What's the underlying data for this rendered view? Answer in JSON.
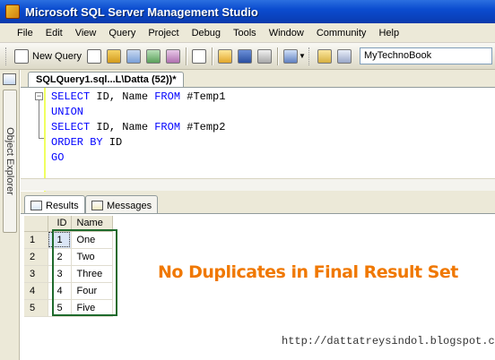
{
  "window": {
    "title": "Microsoft SQL Server Management Studio"
  },
  "menu": [
    "File",
    "Edit",
    "View",
    "Query",
    "Project",
    "Debug",
    "Tools",
    "Window",
    "Community",
    "Help"
  ],
  "toolbar": {
    "new_query_label": "New Query",
    "database": "MyTechnoBook",
    "icons": [
      "new-query-icon",
      "new-file-icon",
      "database-query-icon",
      "mdx-query-icon",
      "dmx-query-icon",
      "xmla-query-icon",
      "copy-icon",
      "open-file-icon",
      "save-icon",
      "print-icon",
      "activity-monitor-icon",
      "query-options-icon",
      "template-icon"
    ]
  },
  "side_panel": {
    "label": "Object Explorer"
  },
  "document_tab": {
    "label": "SQLQuery1.sql...L\\Datta (52))*"
  },
  "editor": {
    "lines": [
      [
        {
          "t": "SELECT",
          "kw": true
        },
        {
          "t": " ID, Name ",
          "kw": false
        },
        {
          "t": "FROM",
          "kw": true
        },
        {
          "t": " #Temp1",
          "kw": false
        }
      ],
      [
        {
          "t": "UNION",
          "kw": true
        }
      ],
      [
        {
          "t": "SELECT",
          "kw": true
        },
        {
          "t": " ID, Name ",
          "kw": false
        },
        {
          "t": "FROM",
          "kw": true
        },
        {
          "t": " #Temp2",
          "kw": false
        }
      ],
      [
        {
          "t": "ORDER BY",
          "kw": true
        },
        {
          "t": " ID",
          "kw": false
        }
      ],
      [
        {
          "t": "GO",
          "kw": true
        }
      ]
    ]
  },
  "results_tabs": {
    "results": "Results",
    "messages": "Messages"
  },
  "grid": {
    "headers": [
      "ID",
      "Name"
    ],
    "rows": [
      {
        "num": "1",
        "id": "1",
        "name": "One"
      },
      {
        "num": "2",
        "id": "2",
        "name": "Two"
      },
      {
        "num": "3",
        "id": "3",
        "name": "Three"
      },
      {
        "num": "4",
        "id": "4",
        "name": "Four"
      },
      {
        "num": "5",
        "id": "5",
        "name": "Five"
      }
    ]
  },
  "annotation": "No Duplicates in Final Result Set",
  "watermark": "http://dattatreysindol.blogspot.com",
  "colors": {
    "keyword": "#0000ff",
    "annotation": "#f07800",
    "highlight_box": "#1e6a2c",
    "titlebar": "#0b4ccf"
  }
}
